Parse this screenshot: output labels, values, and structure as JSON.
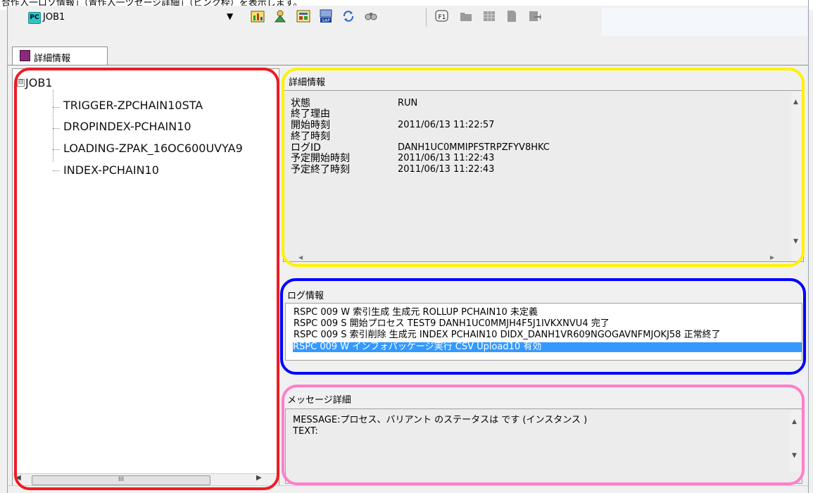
{
  "caption": "合作入一ロソ情報」（青作入一ツセージ詳細」（ピンク枠）を表示します。",
  "toolbar": {
    "job_combo_value": "JOB1",
    "job_combo_icon": "PC",
    "icons": [
      "stats-icon",
      "wizard-icon",
      "report-icon",
      "sap-icon",
      "refresh-icon",
      "find-icon",
      "f1-help-icon",
      "folder-icon",
      "grid-icon",
      "document-icon",
      "export-icon"
    ]
  },
  "tab": {
    "label": "詳細情報"
  },
  "tree": {
    "expander": "⊟",
    "root": "JOB1",
    "children": [
      "TRIGGER-ZPCHAIN10STA",
      "DROPINDEX-PCHAIN10",
      "LOADING-ZPAK_16OC600UVYA9",
      "INDEX-PCHAIN10"
    ],
    "scrollbar_thumb": "III"
  },
  "detail": {
    "title": "詳細情報",
    "labels": [
      "状態",
      "終了理由",
      "開始時刻",
      "終了時刻",
      "ログID",
      "予定開始時刻",
      "予定終了時刻"
    ],
    "values": [
      "RUN",
      "",
      "2011/06/13 11:22:57",
      "",
      "DANH1UC0MMIPFSTRPZFYV8HKC",
      "2011/06/13 11:22:43",
      "2011/06/13 11:22:43"
    ]
  },
  "log": {
    "title": "ログ情報",
    "lines": [
      "RSPC 009 W 索引生成 生成元 ROLLUP PCHAIN10  未定義",
      "RSPC 009 S 開始プロセス TEST9 DANH1UC0MMJH4F5J1IVKXNVU4 完了",
      "RSPC 009 S 索引削除 生成元 INDEX PCHAIN10 DIDX_DANH1VR609NGOGAVNFMJOKJ58 正常終了",
      "RSPC 009 W インフォパッケージ実行 CSV Upload10  有効"
    ],
    "selected_index": 3
  },
  "message": {
    "title": "メッセージ詳細",
    "lines": [
      "MESSAGE:プロセス、バリアント のステータスは です (インスタンス )",
      "TEXT:"
    ]
  },
  "highlight_colors": {
    "tree": "#ee1c24",
    "detail": "#fff200",
    "log": "#0000ff",
    "message": "#ff7ec8"
  },
  "scroll_glyphs": {
    "up": "▲",
    "down": "▼",
    "left": "◀",
    "right": "▶"
  }
}
